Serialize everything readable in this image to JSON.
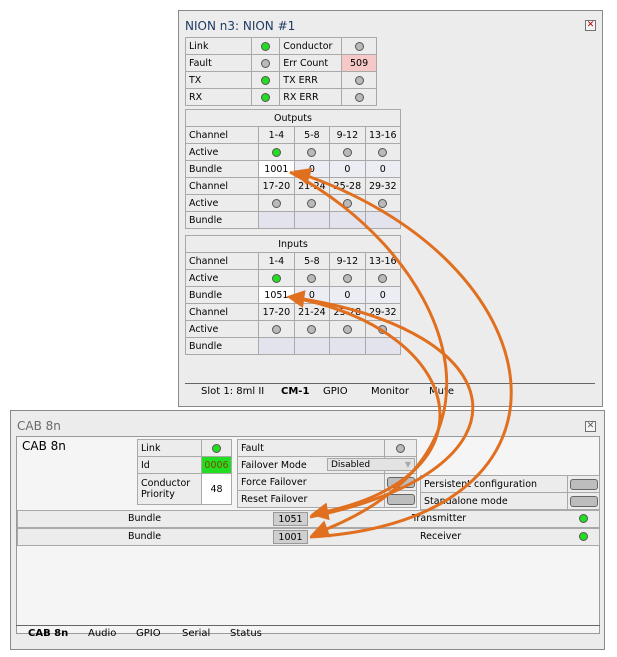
{
  "nion": {
    "title": "NION n3: NION #1",
    "status": {
      "link": "Link",
      "conductor": "Conductor",
      "fault": "Fault",
      "err_count": "Err Count",
      "err_count_value": "509",
      "tx": "TX",
      "tx_err": "TX ERR",
      "rx": "RX",
      "rx_err": "RX ERR"
    },
    "labels": {
      "channel": "Channel",
      "active": "Active",
      "bundle": "Bundle"
    },
    "outputs": {
      "header": "Outputs",
      "ch_a": [
        "1-4",
        "5-8",
        "9-12",
        "13-16"
      ],
      "bundle_a": [
        "1001",
        "0",
        "0",
        "0"
      ],
      "ch_b": [
        "17-20",
        "21-24",
        "25-28",
        "29-32"
      ]
    },
    "inputs": {
      "header": "Inputs",
      "ch_a": [
        "1-4",
        "5-8",
        "9-12",
        "13-16"
      ],
      "bundle_a": [
        "1051",
        "0",
        "0",
        "0"
      ],
      "ch_b": [
        "17-20",
        "21-24",
        "25-28",
        "29-32"
      ]
    },
    "tabs": [
      "Slot 1: 8ml II",
      "CM-1",
      "GPIO",
      "Monitor",
      "Mute"
    ],
    "active_tab": "CM-1"
  },
  "cab": {
    "title": "CAB 8n",
    "name": "CAB 8n",
    "link": "Link",
    "id_label": "Id",
    "id_value": "0006",
    "conductor_priority": "Conductor Priority",
    "priority_value": "48",
    "fault": "Fault",
    "failover_mode": "Failover Mode",
    "failover_value": "Disabled",
    "force_failover": "Force Failover",
    "reset_failover": "Reset Failover",
    "persistent": "Persistent configuration",
    "standalone": "Standalone mode",
    "bundle_label": "Bundle",
    "tx_bundle": "1051",
    "transmitter": "Transmitter",
    "rx_bundle": "1001",
    "receiver": "Receiver",
    "tabs": [
      "CAB 8n",
      "Audio",
      "GPIO",
      "Serial",
      "Status"
    ],
    "active_tab": "CAB 8n"
  },
  "colors": {
    "led_on": "#22dd22",
    "arrow": "#e07020",
    "err_bg": "#f7c8c8",
    "id_bg": "#22dd22"
  }
}
